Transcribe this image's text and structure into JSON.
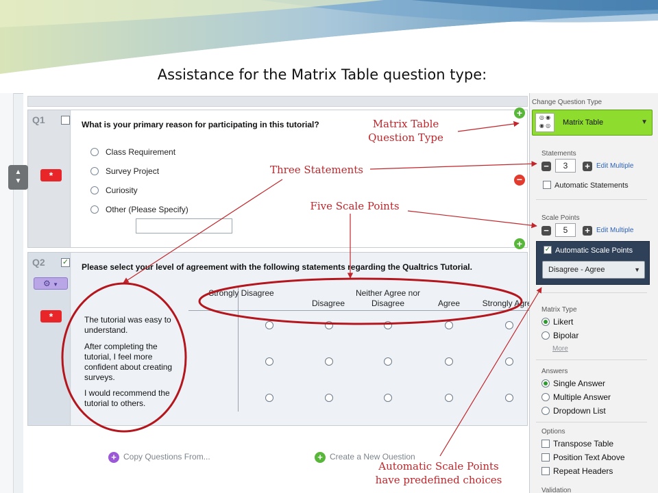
{
  "slide_title": "Assistance for the Matrix Table question type:",
  "q1": {
    "number": "Q1",
    "text": "What is your primary reason for participating in this tutorial?",
    "choices": [
      "Class Requirement",
      "Survey Project",
      "Curiosity",
      "Other (Please Specify)"
    ],
    "required_symbol": "*"
  },
  "q2": {
    "number": "Q2",
    "text": "Please select your level of agreement with the following statements regarding the Qualtrics Tutorial.",
    "required_symbol": "*",
    "scale_points": [
      "Strongly Disagree",
      "Disagree",
      "Neither Agree nor Disagree",
      "Agree",
      "Strongly Agree"
    ],
    "statements": [
      "The tutorial was easy to understand.",
      "After completing the tutorial, I feel more confident about creating surveys.",
      "I would recommend the tutorial to others."
    ]
  },
  "bottom_links": {
    "copy_questions": "Copy Questions From...",
    "create_question": "Create a New Question"
  },
  "sidebar": {
    "change_type_label": "Change Question Type",
    "question_type": "Matrix Table",
    "statements_label": "Statements",
    "statements_value": "3",
    "edit_multiple": "Edit Multiple",
    "automatic_statements": "Automatic Statements",
    "scale_points_label": "Scale Points",
    "scale_points_value": "5",
    "automatic_scale_points": "Automatic Scale Points",
    "scale_preset": "Disagree - Agree",
    "matrix_type_label": "Matrix Type",
    "matrix_types": [
      "Likert",
      "Bipolar"
    ],
    "more_link": "More",
    "answers_label": "Answers",
    "answers": [
      "Single Answer",
      "Multiple Answer",
      "Dropdown List"
    ],
    "options_label": "Options",
    "options": [
      "Transpose Table",
      "Position Text Above",
      "Repeat Headers"
    ],
    "validation_label": "Validation"
  },
  "annotations": {
    "matrix_table": "Matrix Table Question Type",
    "three_statements": "Three Statements",
    "five_scale_points": "Five Scale Points",
    "auto_scale_points": "Automatic Scale Points have predefined choices"
  },
  "colors": {
    "annotation": "#c0262b",
    "required": "#e8262a",
    "question_type_select": "#8ddc2e",
    "add_green": "#58b73a",
    "remove_red": "#e23b2e",
    "copy_purple": "#9b59d8"
  }
}
